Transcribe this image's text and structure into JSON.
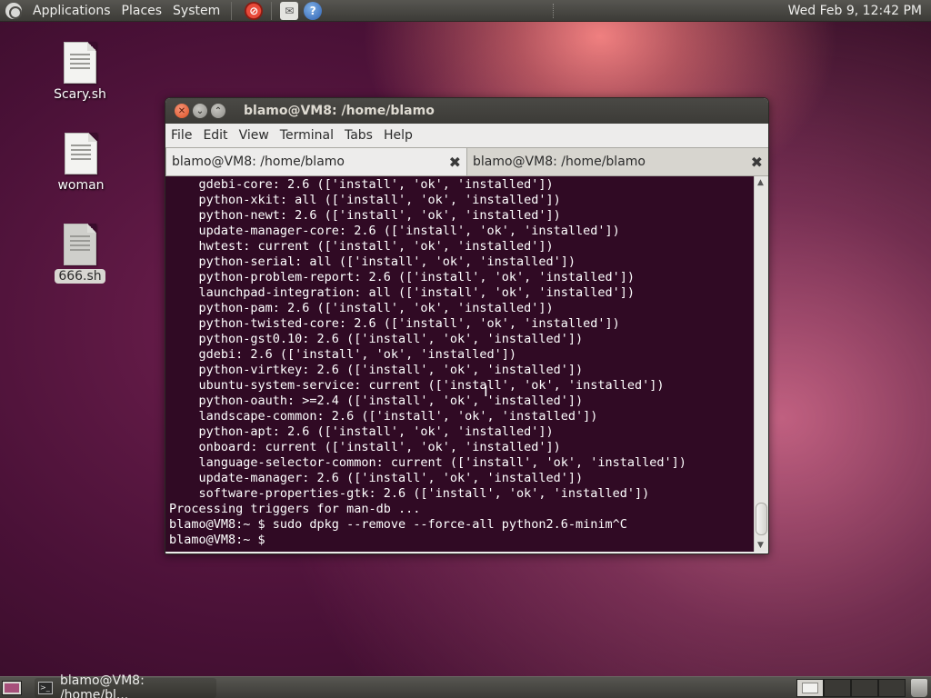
{
  "top_panel": {
    "menus": [
      "Applications",
      "Places",
      "System"
    ],
    "clock": "Wed Feb  9, 12:42 PM"
  },
  "desktop_icons": [
    {
      "label": "Scary.sh"
    },
    {
      "label": "woman"
    },
    {
      "label": "666.sh"
    }
  ],
  "terminal": {
    "window_title": "blamo@VM8: /home/blamo",
    "menu": [
      "File",
      "Edit",
      "View",
      "Terminal",
      "Tabs",
      "Help"
    ],
    "tabs": [
      {
        "label": "blamo@VM8: /home/blamo",
        "active": true
      },
      {
        "label": "blamo@VM8: /home/blamo",
        "active": false
      }
    ],
    "lines": [
      "    gdebi-core: 2.6 (['install', 'ok', 'installed'])",
      "    python-xkit: all (['install', 'ok', 'installed'])",
      "    python-newt: 2.6 (['install', 'ok', 'installed'])",
      "    update-manager-core: 2.6 (['install', 'ok', 'installed'])",
      "    hwtest: current (['install', 'ok', 'installed'])",
      "    python-serial: all (['install', 'ok', 'installed'])",
      "    python-problem-report: 2.6 (['install', 'ok', 'installed'])",
      "    launchpad-integration: all (['install', 'ok', 'installed'])",
      "    python-pam: 2.6 (['install', 'ok', 'installed'])",
      "    python-twisted-core: 2.6 (['install', 'ok', 'installed'])",
      "    python-gst0.10: 2.6 (['install', 'ok', 'installed'])",
      "    gdebi: 2.6 (['install', 'ok', 'installed'])",
      "    python-virtkey: 2.6 (['install', 'ok', 'installed'])",
      "    ubuntu-system-service: current (['install', 'ok', 'installed'])",
      "    python-oauth: >=2.4 (['install', 'ok', 'installed'])",
      "    landscape-common: 2.6 (['install', 'ok', 'installed'])",
      "    python-apt: 2.6 (['install', 'ok', 'installed'])",
      "    onboard: current (['install', 'ok', 'installed'])",
      "    language-selector-common: current (['install', 'ok', 'installed'])",
      "    update-manager: 2.6 (['install', 'ok', 'installed'])",
      "    software-properties-gtk: 2.6 (['install', 'ok', 'installed'])",
      "Processing triggers for man-db ...",
      "blamo@VM8:~ $ sudo dpkg --remove --force-all python2.6-minim^C",
      "blamo@VM8:~ $"
    ]
  },
  "bottom_panel": {
    "task_label": "blamo@VM8: /home/bl..."
  }
}
